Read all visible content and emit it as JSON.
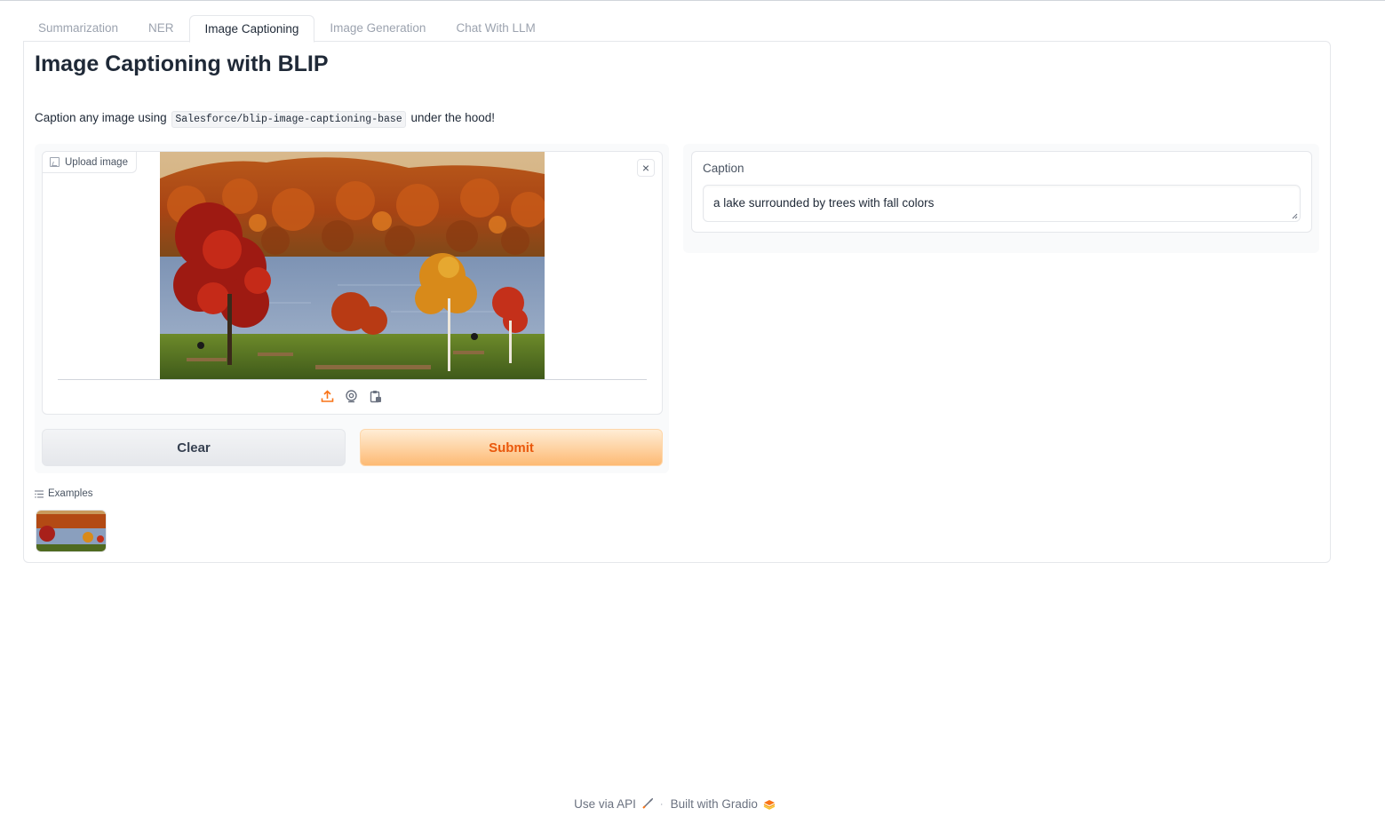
{
  "tabs": [
    {
      "label": "Summarization",
      "active": false
    },
    {
      "label": "NER",
      "active": false
    },
    {
      "label": "Image Captioning",
      "active": true
    },
    {
      "label": "Image Generation",
      "active": false
    },
    {
      "label": "Chat With LLM",
      "active": false
    }
  ],
  "page": {
    "title": "Image Captioning with BLIP",
    "description_prefix": "Caption any image using",
    "model_name": "Salesforce/blip-image-captioning-base",
    "description_suffix": "under the hood!"
  },
  "image_input": {
    "label": "Upload image",
    "close_glyph": "×",
    "source_icons": [
      "upload-icon",
      "webcam-icon",
      "clipboard-icon"
    ]
  },
  "buttons": {
    "clear_label": "Clear",
    "submit_label": "Submit"
  },
  "output": {
    "label": "Caption",
    "value": "a lake surrounded by trees with fall colors"
  },
  "examples": {
    "label": "Examples"
  },
  "footer": {
    "api_label": "Use via API",
    "separator": "·",
    "built_label": "Built with Gradio"
  },
  "colors": {
    "accent": "#f97316",
    "submit_text": "#ea580c",
    "border": "#e5e7eb"
  }
}
